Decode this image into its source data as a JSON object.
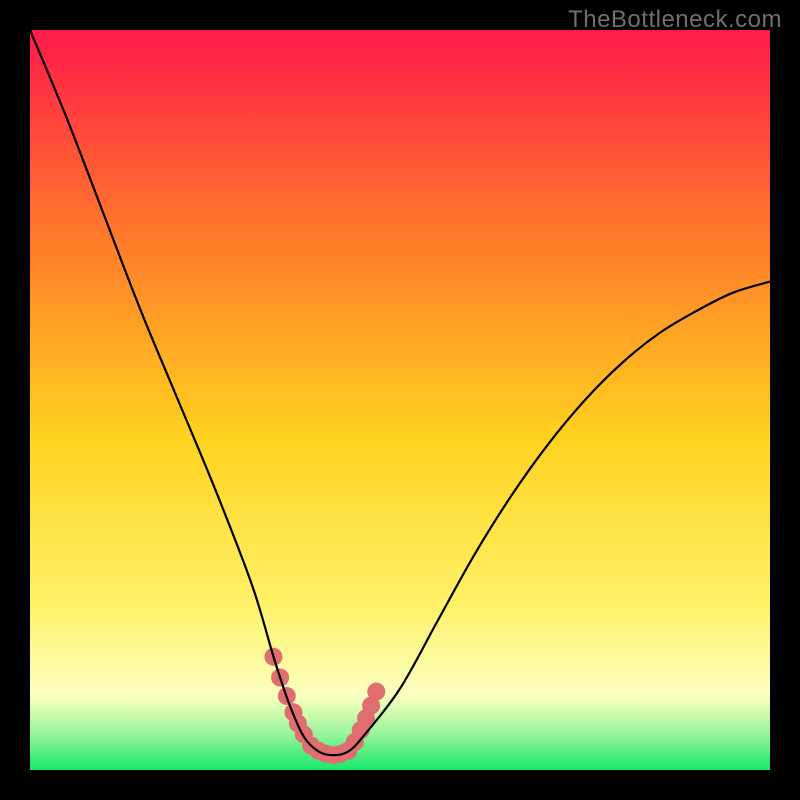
{
  "attribution": "TheBottleneck.com",
  "colors": {
    "frame": "#000000",
    "grad_top": "#ff1a4b",
    "grad_mid1": "#ff7a2a",
    "grad_mid2": "#ffd21f",
    "grad_mid3": "#fff26a",
    "grad_low": "#fbffc0",
    "grad_green_light": "#9af59a",
    "grad_green": "#17e86b",
    "curve": "#000000",
    "highlight": "#e06e71",
    "highlight_stroke": "#e06e71"
  },
  "chart_data": {
    "type": "line",
    "title": "",
    "xlabel": "",
    "ylabel": "",
    "xlim": [
      0,
      100
    ],
    "ylim": [
      0,
      100
    ],
    "series": [
      {
        "name": "bottleneck-curve",
        "x": [
          0,
          5,
          10,
          15,
          20,
          25,
          30,
          33,
          35,
          37,
          39,
          41,
          43,
          45,
          50,
          55,
          60,
          65,
          70,
          75,
          80,
          85,
          90,
          95,
          100
        ],
        "y": [
          100,
          88,
          75,
          62,
          50,
          38,
          25,
          15,
          9,
          4.5,
          2.5,
          2,
          2.5,
          4.5,
          11,
          20,
          29,
          37,
          44,
          50,
          55,
          59,
          62,
          64.5,
          66
        ]
      }
    ],
    "highlights_x": [
      32.9,
      33.8,
      34.7,
      35.6,
      36.2,
      37.0,
      38.0,
      39.0,
      40.0,
      41.0,
      42.0,
      43.0,
      43.9,
      44.7,
      45.4,
      46.1,
      46.8
    ],
    "highlights_y": [
      15.3,
      12.5,
      10.0,
      7.8,
      6.3,
      4.8,
      3.3,
      2.6,
      2.2,
      2.0,
      2.2,
      2.6,
      3.8,
      5.4,
      7.0,
      8.7,
      10.6
    ],
    "annotations": []
  }
}
